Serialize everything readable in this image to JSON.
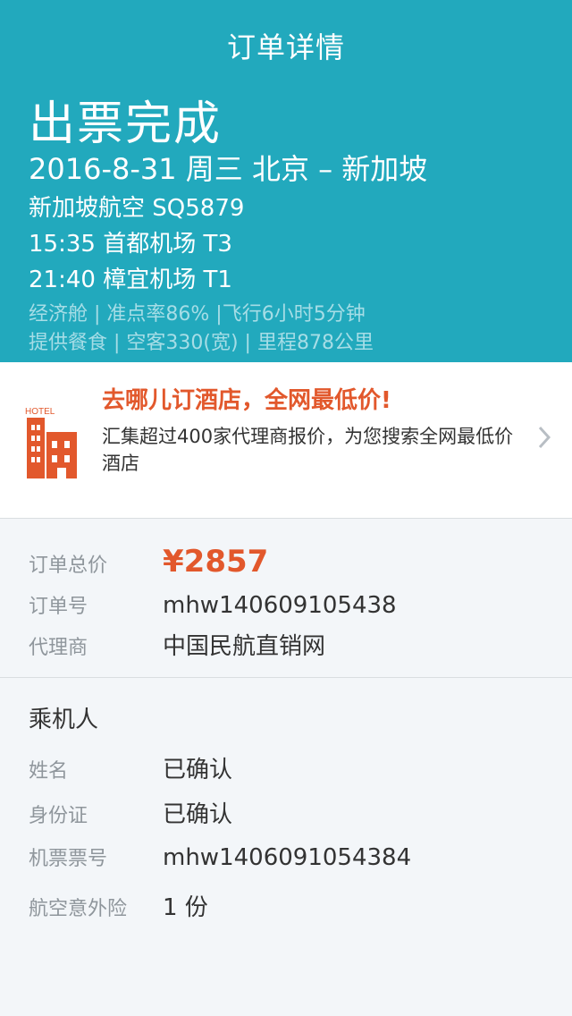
{
  "nav": {
    "title": "订单详情"
  },
  "flight": {
    "status": "出票完成",
    "route": "2016-8-31  周三  北京 – 新加坡",
    "airline": "新加坡航空 SQ5879",
    "departure": "15:35  首都机场  T3",
    "arrival": "21:40  樟宜机场  T1",
    "meta1": "经济舱 | 准点率86% |飞行6小时5分钟",
    "meta2": "提供餐食 | 空客330(宽) | 里程878公里"
  },
  "hotel_promo": {
    "icon": "hotel-building-icon",
    "icon_text": "HOTEL",
    "title": "去哪儿订酒店，全网最低价!",
    "desc": "汇集超过400家代理商报价，为您搜索全网最低价酒店"
  },
  "order": {
    "total_label": "订单总价",
    "total_value": "¥2857",
    "number_label": "订单号",
    "number_value": "mhw140609105438",
    "agent_label": "代理商",
    "agent_value": "中国民航直销网"
  },
  "passenger": {
    "section_title": "乘机人",
    "name_label": "姓名",
    "name_value": "已确认",
    "id_label": "身份证",
    "id_value": "已确认",
    "ticket_label": "机票票号",
    "ticket_value": "mhw1406091054384",
    "insurance_label": "航空意外险",
    "insurance_value": "1 份"
  },
  "colors": {
    "header_bg": "#22a9bd",
    "accent_orange": "#e2582c",
    "page_bg": "#f3f6f9"
  }
}
